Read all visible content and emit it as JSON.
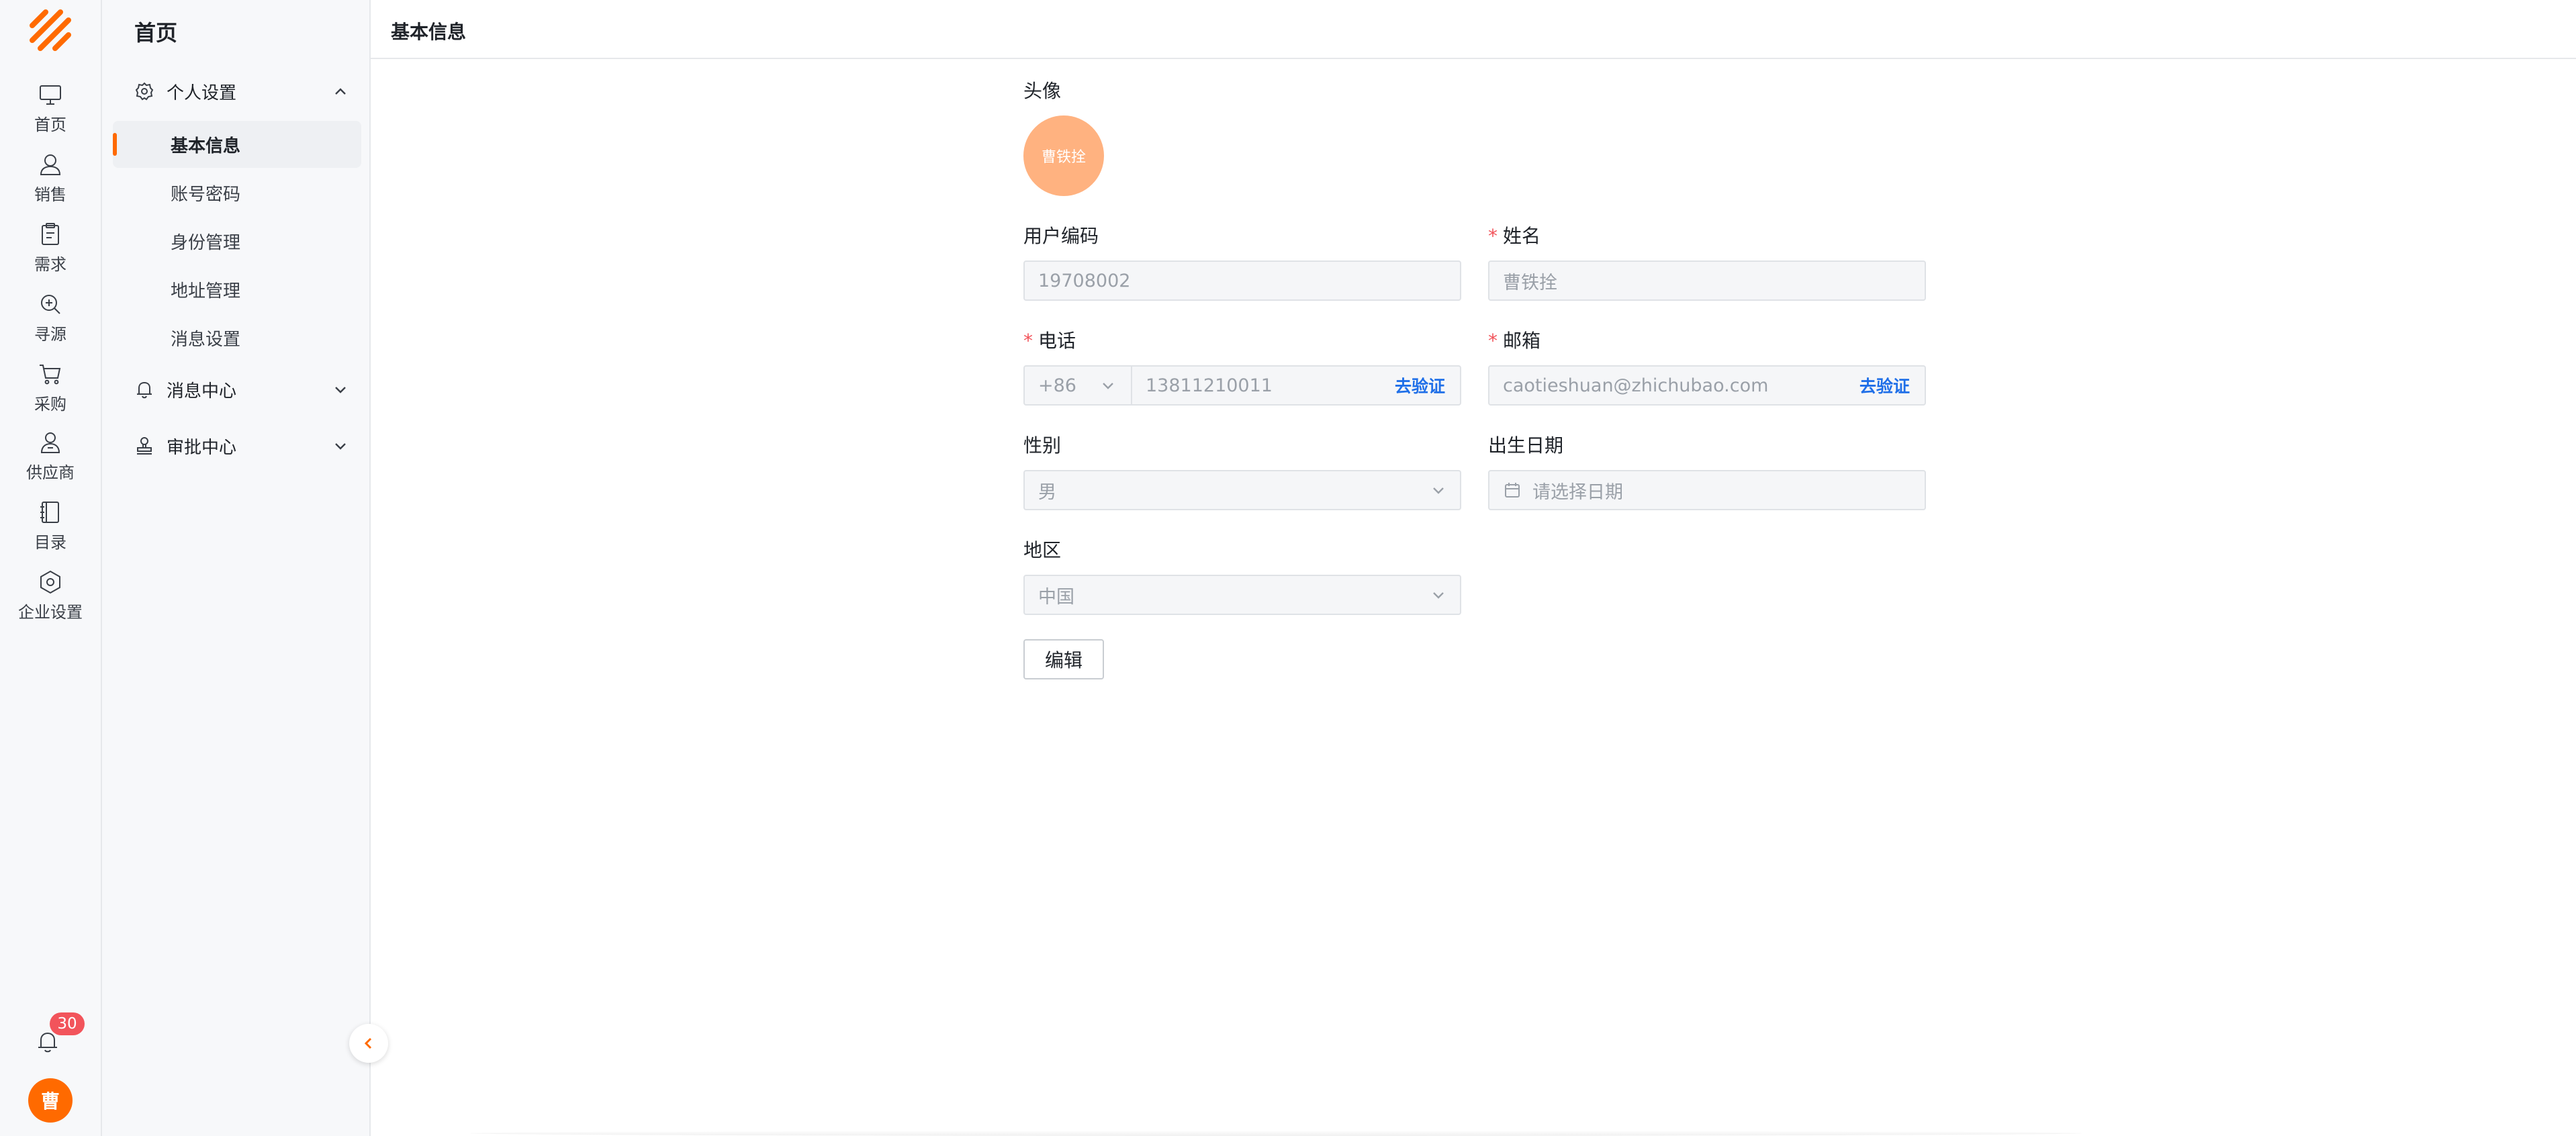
{
  "rail": {
    "items": [
      {
        "label": "首页",
        "icon": "monitor-icon"
      },
      {
        "label": "销售",
        "icon": "user-icon"
      },
      {
        "label": "需求",
        "icon": "clipboard-icon"
      },
      {
        "label": "寻源",
        "icon": "zoom-in-icon"
      },
      {
        "label": "采购",
        "icon": "cart-icon"
      },
      {
        "label": "供应商",
        "icon": "supplier-icon"
      },
      {
        "label": "目录",
        "icon": "book-icon"
      },
      {
        "label": "企业设置",
        "icon": "hexagon-settings-icon"
      }
    ],
    "notification_count": "30",
    "avatar_text": "曹"
  },
  "sidebar": {
    "title": "首页",
    "groups": [
      {
        "label": "个人设置",
        "icon": "gear-icon",
        "expanded": true,
        "items": [
          "基本信息",
          "账号密码",
          "身份管理",
          "地址管理",
          "消息设置"
        ],
        "active": "基本信息"
      },
      {
        "label": "消息中心",
        "icon": "bell-icon",
        "expanded": false
      },
      {
        "label": "审批中心",
        "icon": "stamp-icon",
        "expanded": false
      }
    ]
  },
  "page": {
    "title": "基本信息"
  },
  "form": {
    "avatar_label": "头像",
    "avatar_text": "曹铁拴",
    "user_code_label": "用户编码",
    "user_code_value": "19708002",
    "name_label": "姓名",
    "name_value": "曹铁拴",
    "phone_label": "电话",
    "phone_prefix": "+86",
    "phone_value": "13811210011",
    "phone_verify": "去验证",
    "email_label": "邮箱",
    "email_value": "caotieshuan@zhichubao.com",
    "email_verify": "去验证",
    "gender_label": "性别",
    "gender_value": "男",
    "birth_label": "出生日期",
    "birth_placeholder": "请选择日期",
    "region_label": "地区",
    "region_value": "中国",
    "edit_button": "编辑"
  },
  "colors": {
    "accent": "#ff6a00",
    "link": "#1f6fe8",
    "badge": "#f2545b",
    "required": "#f2545b"
  }
}
